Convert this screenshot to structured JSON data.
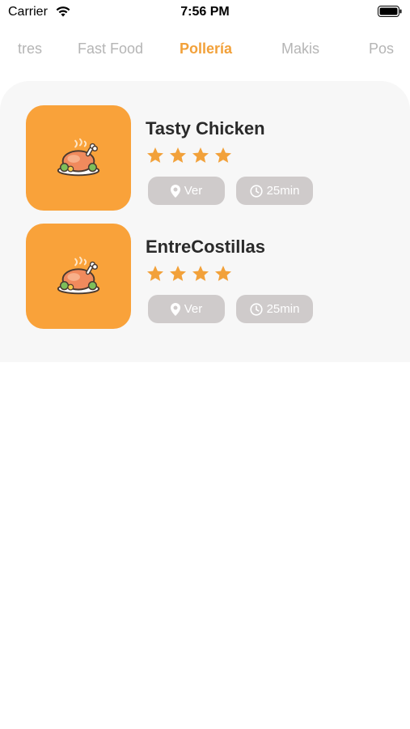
{
  "status_bar": {
    "carrier": "Carrier",
    "time": "7:56 PM"
  },
  "tabs": [
    {
      "label": "tres",
      "active": false
    },
    {
      "label": "Fast Food",
      "active": false
    },
    {
      "label": "Pollería",
      "active": true
    },
    {
      "label": "Makis",
      "active": false
    },
    {
      "label": "Pos",
      "active": false
    }
  ],
  "restaurants": [
    {
      "name": "Tasty Chicken",
      "rating": 4,
      "location_label": "Ver",
      "time_label": "25min",
      "image_icon": "roast-chicken-icon"
    },
    {
      "name": "EntreCostillas",
      "rating": 4,
      "location_label": "Ver",
      "time_label": "25min",
      "image_icon": "roast-chicken-icon"
    }
  ],
  "colors": {
    "accent": "#f2a13a",
    "thumb_bg": "#f9a23a",
    "pill_bg": "#cfcbcb",
    "panel_bg": "#f7f7f7",
    "tab_inactive": "#b5b5b5"
  }
}
